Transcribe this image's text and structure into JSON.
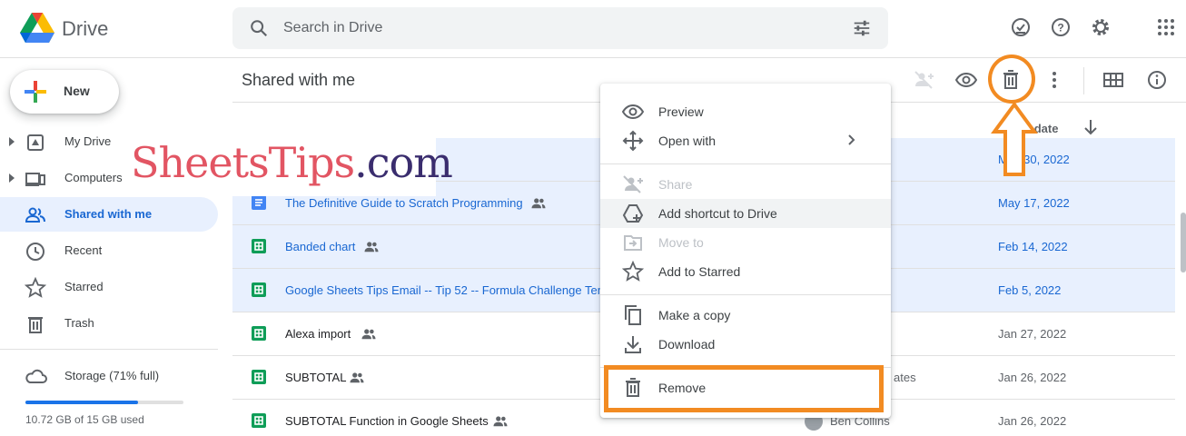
{
  "app": {
    "name": "Drive"
  },
  "search": {
    "placeholder": "Search in Drive"
  },
  "sidebar": {
    "new_label": "New",
    "items": [
      {
        "label": "My Drive"
      },
      {
        "label": "Computers"
      },
      {
        "label": "Shared with me"
      },
      {
        "label": "Recent"
      },
      {
        "label": "Starred"
      },
      {
        "label": "Trash"
      }
    ],
    "storage": {
      "label": "Storage (71% full)",
      "used_text": "10.72 GB of 15 GB used",
      "fraction": 0.71
    }
  },
  "watermark": {
    "part1": "SheetsTips",
    "part2": ".com"
  },
  "main": {
    "title": "Shared with me",
    "columns": {
      "share_date": "Share date"
    }
  },
  "files": [
    {
      "name": "",
      "date": "May 30, 2022",
      "type": "doc",
      "selected": true
    },
    {
      "name": "The Definitive Guide to Scratch Programming",
      "date": "May 17, 2022",
      "type": "doc",
      "selected": true
    },
    {
      "name": "Banded chart",
      "date": "Feb 14, 2022",
      "type": "sheet",
      "selected": true
    },
    {
      "name": "Google Sheets Tips Email -- Tip 52 -- Formula Challenge Ten",
      "date": "Feb 5, 2022",
      "type": "sheet",
      "selected": true
    },
    {
      "name": "Alexa import",
      "date": "Jan 27, 2022",
      "type": "sheet",
      "selected": false
    },
    {
      "name": "SUBTOTAL",
      "date": "Jan 26, 2022",
      "type": "sheet",
      "selected": false,
      "owner": "ates"
    },
    {
      "name": "SUBTOTAL Function in Google Sheets",
      "date": "Jan 26, 2022",
      "type": "sheet",
      "selected": false,
      "owner": "Ben Collins"
    }
  ],
  "context_menu": {
    "items": [
      {
        "label": "Preview",
        "icon": "eye-icon"
      },
      {
        "label": "Open with",
        "icon": "move-icon"
      },
      {
        "label": "Share",
        "icon": "person-add-icon",
        "disabled": true
      },
      {
        "label": "Add shortcut to Drive",
        "icon": "shortcut-icon"
      },
      {
        "label": "Move to",
        "icon": "folder-move-icon",
        "disabled": true
      },
      {
        "label": "Add to Starred",
        "icon": "star-icon"
      },
      {
        "label": "Make a copy",
        "icon": "copy-icon"
      },
      {
        "label": "Download",
        "icon": "download-icon"
      },
      {
        "label": "Remove",
        "icon": "trash-icon"
      }
    ]
  },
  "colors": {
    "accent": "#1a73e8",
    "selection": "#e8f0fe",
    "annotation": "#f28b22",
    "sheet": "#0f9d58",
    "doc": "#4285f4"
  }
}
